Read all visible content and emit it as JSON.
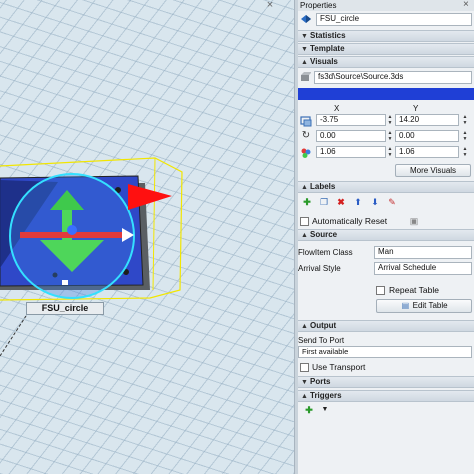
{
  "viewport": {
    "close_glyph": "×",
    "object_label": "FSU_circle"
  },
  "panel": {
    "title": "Properties",
    "close_glyph": "×",
    "object_name": "FSU_circle",
    "sections": {
      "statistics": "Statistics",
      "template": "Template",
      "visuals": "Visuals",
      "labels": "Labels",
      "source": "Source",
      "output": "Output",
      "ports": "Ports",
      "triggers": "Triggers"
    },
    "visuals": {
      "shape_path": "fs3d\\Source\\Source.3ds",
      "color_bar": "#1f3fd6",
      "col_x": "X",
      "col_y": "Y",
      "position": {
        "x": "-3.75",
        "y": "14.20"
      },
      "rotation": {
        "x": "0.00",
        "y": "0.00"
      },
      "size": {
        "x": "1.06",
        "y": "1.06"
      },
      "more_button": "More Visuals"
    },
    "labels": {
      "auto_reset": "Automatically Reset",
      "auto_reset_checked": false
    },
    "source": {
      "flowitem_label": "FlowItem Class",
      "flowitem_value": "Man",
      "arrival_label": "Arrival Style",
      "arrival_value": "Arrival Schedule",
      "repeat_label": "Repeat Table",
      "repeat_checked": false,
      "edit_button": "Edit Table"
    },
    "output": {
      "send_label": "Send To Port",
      "send_value": "First available",
      "transport_label": "Use Transport",
      "transport_checked": false
    }
  }
}
